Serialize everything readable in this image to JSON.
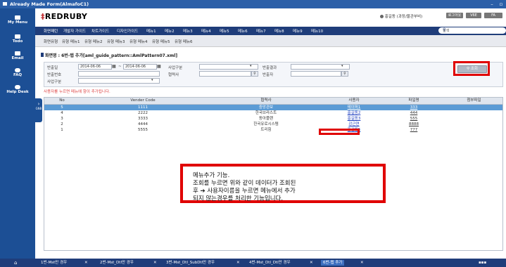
{
  "window": {
    "title": "Already Made Form(AlmafoC1)"
  },
  "sidebar": {
    "items": [
      {
        "label": "My Menu",
        "icon": "person-icon"
      },
      {
        "label": "Todo",
        "icon": "calendar-icon"
      },
      {
        "label": "Email",
        "icon": "mail-icon"
      },
      {
        "label": "FAQ",
        "icon": "question-icon"
      },
      {
        "label": "Help Desk",
        "icon": "headset-icon"
      }
    ],
    "collapse_tab": "GNB"
  },
  "header": {
    "logo_mark": "‡",
    "logo_text": "REDRUBY",
    "user_info": "홍길동 (과장/물관부비)",
    "buttons": [
      "로그아웃",
      "V6E",
      "FA"
    ]
  },
  "top_nav": {
    "items": [
      "화면패턴",
      "개발자 가이드",
      "차트가이드",
      "디자인가이드",
      "메뉴1",
      "메뉴2",
      "메뉴3",
      "메뉴4",
      "메뉴5",
      "메뉴6",
      "메뉴7",
      "메뉴8",
      "메뉴9",
      "메뉴10"
    ],
    "search_placeholder": "검색"
  },
  "sub_nav": {
    "items": [
      "화면유형",
      "유형 메뉴1",
      "유형 메뉴2",
      "유형 메뉴3",
      "유형 메뉴4",
      "유형 메뉴5",
      "유형 메뉴6"
    ]
  },
  "breadcrumb": "화면명 : 6번-탭 추가[aml_guide_pattern::AmlPattern07.xml]",
  "filters": {
    "row1": {
      "date_label": "반출일",
      "date_from": "2014-06-06",
      "date_to": "2014-06-06",
      "biz_type_label": "사업구분",
      "result_label": "반출결과"
    },
    "row2": {
      "no_label": "반출번호",
      "cooperator_label": "협력사",
      "requester_label": "반출자"
    },
    "row3": {
      "biz_label": "사업구분"
    },
    "search_button": "조회"
  },
  "table": {
    "note": "사용자를 누르면 메뉴에 항이 추가됩니다.",
    "columns": [
      "No",
      "Vender Code",
      "협력사",
      "사용자",
      "파일명",
      "첨부파일"
    ],
    "rows": [
      {
        "no": "5",
        "code": "1111",
        "company": "중앙관보",
        "user": "테이퍼1",
        "file": "333",
        "selected": true
      },
      {
        "no": "4",
        "code": "2222",
        "company": "한국브라스트",
        "user": "홍길동2",
        "file": "444",
        "selected": false
      },
      {
        "no": "3",
        "code": "3333",
        "company": "동아플랜",
        "user": "홍길동3",
        "file": "555",
        "selected": false
      },
      {
        "no": "2",
        "code": "4444",
        "company": "한국유로시스템",
        "user": "강근연",
        "file": "8888",
        "selected": false
      },
      {
        "no": "1",
        "code": "5555",
        "company": "트리힘",
        "user": "홍길동5",
        "file": "777",
        "selected": false
      }
    ]
  },
  "annotation": {
    "line1": "메뉴추가 기능.",
    "line2": "조회를 누르면 위와 같이 데이터가 조회된",
    "line3": "후 ➔ 사용자이름을 누르면 메뉴에서 추가",
    "line4": "되지 않는경우를 처리한 기능입니다."
  },
  "taskbar": {
    "tabs": [
      "1번-Mst만 경우",
      "2번-Mst_Dtl만 경우",
      "3번-Mst_Dtl_SubDtl만 경우",
      "4번-Mst_Dtl_Dtl만 경우",
      "6번-탭 추가"
    ]
  },
  "colors": {
    "brand": "#c0282d",
    "nav": "#1f3d7a",
    "sidebar": "#1c4f95",
    "highlight": "#e00000",
    "selected_row": "#5b9bd5"
  }
}
